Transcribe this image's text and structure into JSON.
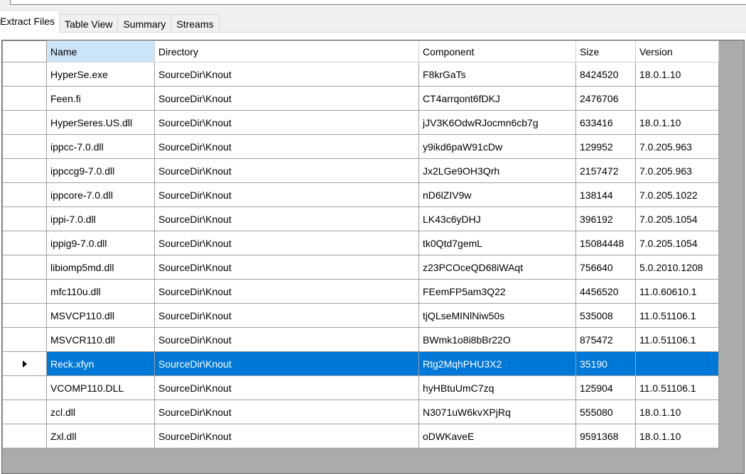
{
  "tabs": [
    {
      "label": "Extract Files",
      "active": true
    },
    {
      "label": "Table View",
      "active": false
    },
    {
      "label": "Summary",
      "active": false
    },
    {
      "label": "Streams",
      "active": false
    }
  ],
  "grid": {
    "columns": [
      "Name",
      "Directory",
      "Component",
      "Size",
      "Version"
    ],
    "sorted_column": "Name",
    "selected_row": 12,
    "rows": [
      {
        "name": "HyperSe.exe",
        "directory": "SourceDir\\Knout",
        "component": "F8krGaTs",
        "size": "8424520",
        "version": "18.0.1.10"
      },
      {
        "name": "Feen.fi",
        "directory": "SourceDir\\Knout",
        "component": "CT4arrqont6fDKJ",
        "size": "2476706",
        "version": ""
      },
      {
        "name": "HyperSeres.US.dll",
        "directory": "SourceDir\\Knout",
        "component": "jJV3K6OdwRJocmn6cb7g",
        "size": "633416",
        "version": "18.0.1.10"
      },
      {
        "name": "ippcc-7.0.dll",
        "directory": "SourceDir\\Knout",
        "component": "y9ikd6paW91cDw",
        "size": "129952",
        "version": "7.0.205.963"
      },
      {
        "name": "ippccg9-7.0.dll",
        "directory": "SourceDir\\Knout",
        "component": "Jx2LGe9OH3Qrh",
        "size": "2157472",
        "version": "7.0.205.963"
      },
      {
        "name": "ippcore-7.0.dll",
        "directory": "SourceDir\\Knout",
        "component": "nD6lZIV9w",
        "size": "138144",
        "version": "7.0.205.1022"
      },
      {
        "name": "ippi-7.0.dll",
        "directory": "SourceDir\\Knout",
        "component": "LK43c6yDHJ",
        "size": "396192",
        "version": "7.0.205.1054"
      },
      {
        "name": "ippig9-7.0.dll",
        "directory": "SourceDir\\Knout",
        "component": "tk0Qtd7gemL",
        "size": "15084448",
        "version": "7.0.205.1054"
      },
      {
        "name": "libiomp5md.dll",
        "directory": "SourceDir\\Knout",
        "component": "z23PCOceQD68iWAqt",
        "size": "756640",
        "version": "5.0.2010.1208"
      },
      {
        "name": "mfc110u.dll",
        "directory": "SourceDir\\Knout",
        "component": "FEemFP5am3Q22",
        "size": "4456520",
        "version": "11.0.60610.1"
      },
      {
        "name": "MSVCP110.dll",
        "directory": "SourceDir\\Knout",
        "component": "tjQLseMINlNiw50s",
        "size": "535008",
        "version": "11.0.51106.1"
      },
      {
        "name": "MSVCR110.dll",
        "directory": "SourceDir\\Knout",
        "component": "BWmk1o8i8bBr22O",
        "size": "875472",
        "version": "11.0.51106.1"
      },
      {
        "name": "Reck.xfyn",
        "directory": "SourceDir\\Knout",
        "component": "Rtg2MqhPHU3X2",
        "size": "35190",
        "version": ""
      },
      {
        "name": "VCOMP110.DLL",
        "directory": "SourceDir\\Knout",
        "component": "hyHBtuUmC7zq",
        "size": "125904",
        "version": "11.0.51106.1"
      },
      {
        "name": "zcl.dll",
        "directory": "SourceDir\\Knout",
        "component": "N3071uW6kvXPjRq",
        "size": "555080",
        "version": "18.0.1.10"
      },
      {
        "name": "Zxl.dll",
        "directory": "SourceDir\\Knout",
        "component": "oDWKaveE",
        "size": "9591368",
        "version": "18.0.1.10"
      }
    ]
  },
  "colors": {
    "selection": "#0078d7",
    "sorted_header": "#cce4f7",
    "grid_background": "#ababab"
  }
}
